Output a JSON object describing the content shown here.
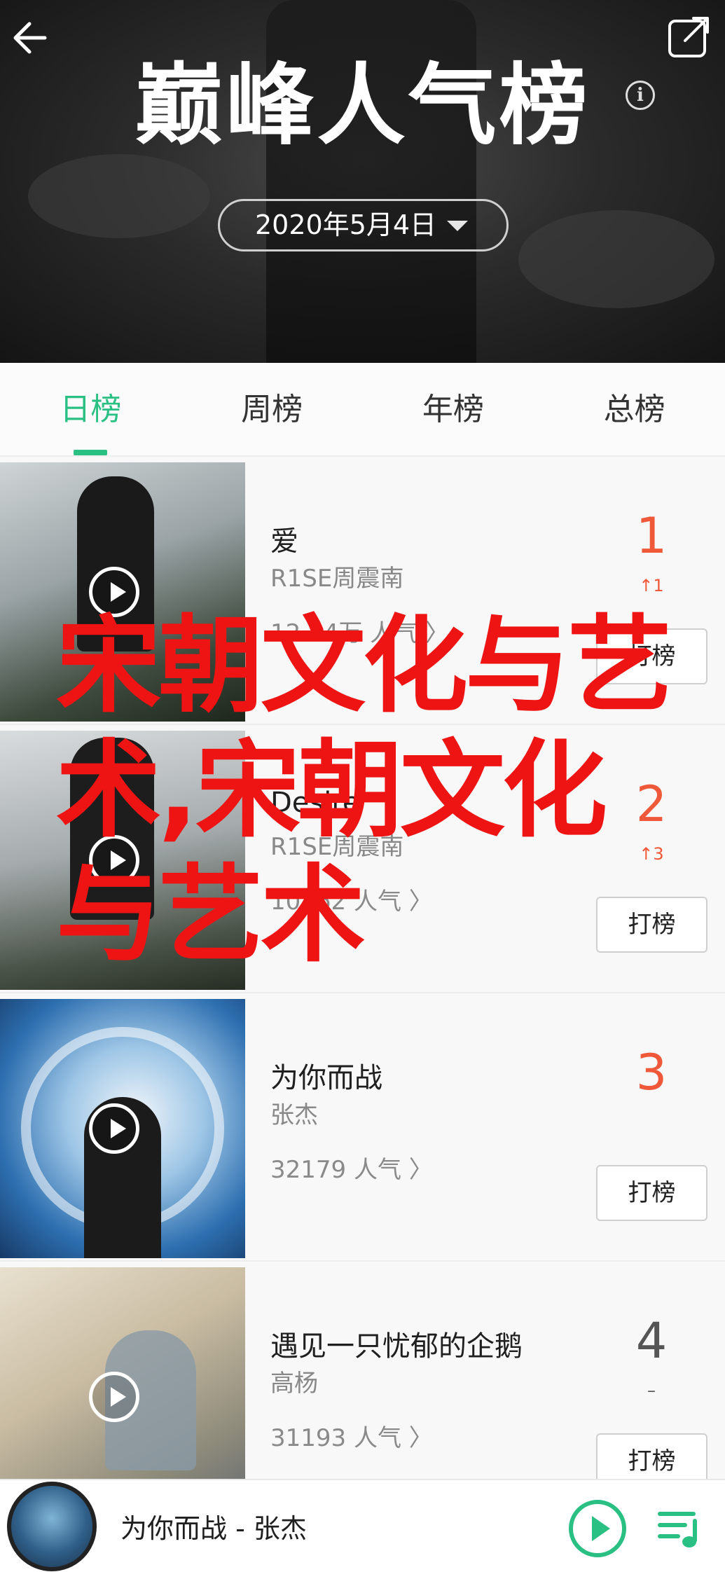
{
  "header": {
    "title": "巅峰人气榜",
    "date": "2020年5月4日",
    "info_glyph": "i"
  },
  "tabs": [
    {
      "label": "日榜",
      "active": true
    },
    {
      "label": "周榜",
      "active": false
    },
    {
      "label": "年榜",
      "active": false
    },
    {
      "label": "总榜",
      "active": false
    }
  ],
  "songs": [
    {
      "title": "爱",
      "artist": "R1SE周震南",
      "popularity": "12.24万 人气",
      "rank": "1",
      "trend": "↑1"
    },
    {
      "title": "Desire",
      "artist": "R1SE周震南",
      "popularity": "10862 人气",
      "rank": "2",
      "trend": "↑3"
    },
    {
      "title": "为你而战",
      "artist": "张杰",
      "popularity": "32179 人气",
      "rank": "3",
      "trend": ""
    },
    {
      "title": "遇见一只忧郁的企鹅",
      "artist": "高杨",
      "popularity": "31193 人气",
      "rank": "4",
      "trend": "–"
    }
  ],
  "vote_label": "打榜",
  "watermark": "宋朝文化与艺术,宋朝文化与艺术",
  "player": {
    "now_playing": "为你而战 - 张杰"
  },
  "colors": {
    "accent": "#2bc083",
    "rank_red": "#f0583a",
    "watermark": "#ee1414"
  },
  "icons": [
    "back-arrow-icon",
    "share-icon",
    "info-icon",
    "dropdown-caret-icon",
    "play-icon",
    "queue-icon"
  ]
}
